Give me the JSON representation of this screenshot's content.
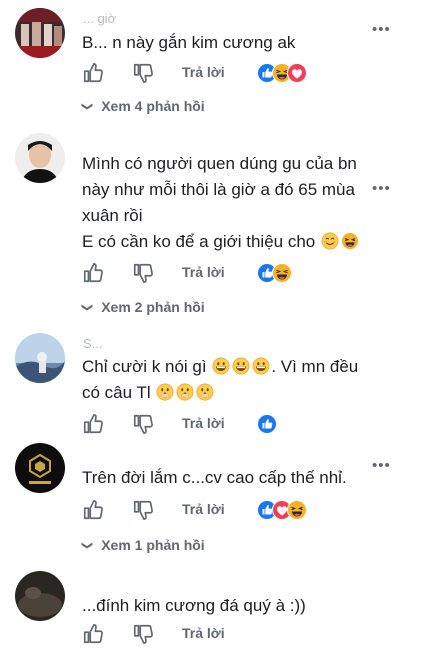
{
  "comments": [
    {
      "meta": "... giờ",
      "text_lines": [
        "B... n này gắn kim cương ak"
      ],
      "reply_label": "Trả lời",
      "view_replies": "Xem 4 phản hồi"
    },
    {
      "meta": "",
      "text_lines": [
        "Mình có người quen dúng gu của bn",
        "này như mỗi thôi là giờ a đó 65 mùa",
        "xuân rồi",
        "E có cần ko để a giới thiệu cho"
      ],
      "reply_label": "Trả lời",
      "view_replies": "Xem 2 phản hồi"
    },
    {
      "meta": "S...",
      "text_lines": [
        "Chỉ cười k nói gì",
        ". Vì mn đều",
        "có câu Tl"
      ],
      "reply_label": "Trả lời"
    },
    {
      "meta": "",
      "text_lines": [
        "Trên đời lắm c...cv cao cấp thế nhỉ."
      ],
      "reply_label": "Trả lời",
      "view_replies": "Xem 1 phản hồi"
    },
    {
      "meta": "",
      "text_lines": [
        "...đính kim cương đá quý à :))"
      ],
      "reply_label": "Trả lời"
    }
  ],
  "more_label": "•••",
  "icons": {
    "like": "thumbs-up-icon",
    "dislike": "thumbs-down-icon",
    "chevron": "chevron-down-icon"
  },
  "colors": {
    "like_blue": "#1877f2",
    "love_red": "#f33e58",
    "haha_yellow": "#f7b125",
    "secondary_text": "#606770"
  }
}
